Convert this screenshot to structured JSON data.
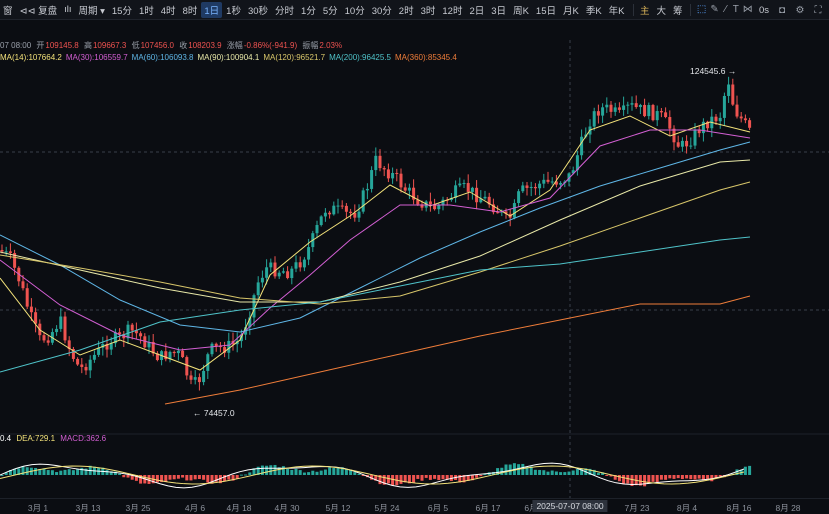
{
  "toolbar": {
    "items": [
      {
        "label": "窗"
      },
      {
        "label": "⊲⊲ 复盘"
      },
      {
        "label": "ılı"
      },
      {
        "label": "周期 ▾"
      },
      {
        "label": "15分"
      },
      {
        "label": "1时"
      },
      {
        "label": "4时"
      },
      {
        "label": "8时"
      },
      {
        "label": "1日",
        "active": true
      },
      {
        "label": "1秒"
      },
      {
        "label": "30秒"
      },
      {
        "label": "分时"
      },
      {
        "label": "1分"
      },
      {
        "label": "5分"
      },
      {
        "label": "10分"
      },
      {
        "label": "30分"
      },
      {
        "label": "2时"
      },
      {
        "label": "3时"
      },
      {
        "label": "12时"
      },
      {
        "label": "2日"
      },
      {
        "label": "3日"
      },
      {
        "label": "周K"
      },
      {
        "label": "15日"
      },
      {
        "label": "月K"
      },
      {
        "label": "季K"
      },
      {
        "label": "年K"
      }
    ],
    "indicator_tabs": [
      "主",
      "大",
      "筹"
    ],
    "right_label": "0s"
  },
  "ohlc": {
    "date_label": "07 08:00",
    "open_label": "开",
    "open": "109145.8",
    "high_label": "高",
    "high": "109667.3",
    "low_label": "低",
    "low": "107456.0",
    "close_label": "收",
    "close": "108203.9",
    "change_label": "涨幅",
    "change": "-0.86%(-941.9)",
    "amp_label": "振幅",
    "amp": "2.03%"
  },
  "ma": [
    {
      "label": "MA(14):107664.2",
      "color": "#f3e27a"
    },
    {
      "label": "MA(30):106559.7",
      "color": "#d35fd3"
    },
    {
      "label": "MA(60):106093.8",
      "color": "#5fb6e6"
    },
    {
      "label": "MA(90):100904.1",
      "color": "#e8e8a8"
    },
    {
      "label": "MA(120):96521.7",
      "color": "#d8c66a"
    },
    {
      "label": "MA(200):96425.5",
      "color": "#4fc3c9"
    },
    {
      "label": "MA(360):85345.4",
      "color": "#ef7d3a"
    }
  ],
  "annotations": {
    "high_marker": "124545.6",
    "low_marker": "74457.0"
  },
  "macd": {
    "diff": "0.4",
    "dea": "DEA:729.1",
    "macd": "MACD:362.6",
    "colors": {
      "diff": "#ffffff",
      "dea": "#f3e27a",
      "macd": "#d35fd3"
    }
  },
  "xaxis": {
    "ticks": [
      "3月 1",
      "3月 13",
      "3月 25",
      "4月 6",
      "4月 18",
      "4月 30",
      "5月 12",
      "5月 24",
      "6月 5",
      "6月 17",
      "6月",
      "7月 23",
      "8月 4",
      "8月 16",
      "8月 28"
    ],
    "crosshair_label": "2025-07-07 08:00"
  },
  "colors": {
    "up": "#26a69a",
    "down": "#ef5350",
    "background": "#0b0d12",
    "accent": "#3d8bff"
  }
}
